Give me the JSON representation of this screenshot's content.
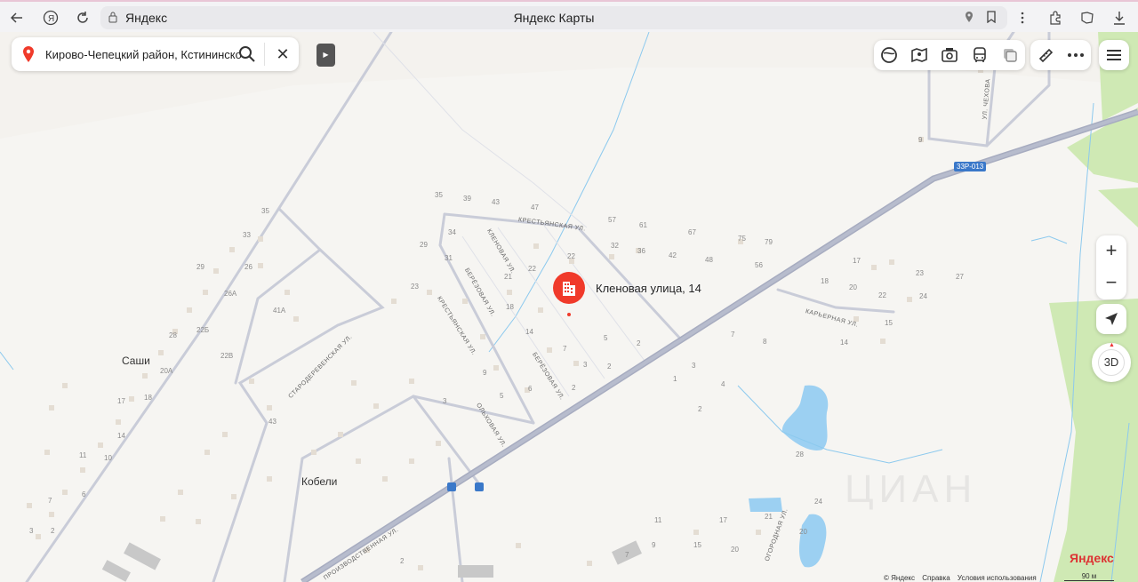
{
  "browser": {
    "site": "Яндекс",
    "page_title": "Яндекс Карты",
    "accent_color": "#e9c6d6"
  },
  "search": {
    "value": "Кирово-Чепецкий район, Кстининское"
  },
  "marker": {
    "label": "Кленовая улица, 14",
    "color": "#f03a2a"
  },
  "highway_badge": "33Р-013",
  "villages": [
    "Саши",
    "Кобели"
  ],
  "streets": [
    "КРЕСТЬЯНСКАЯ УЛ.",
    "КЛЕНОВАЯ УЛ.",
    "БЕРЁЗОВАЯ УЛ.",
    "КРЕСТЬЯНСКАЯ УЛ.",
    "БЕРЁЗОВАЯ УЛ.",
    "ОЛЬХОВАЯ УЛ.",
    "СТАРОДЕРЕВЕНСКАЯ УЛ.",
    "ПРОИЗВОДСТВЕННАЯ УЛ.",
    "КАРЬЕРНАЯ УЛ.",
    "ОГОРОДНАЯ УЛ.",
    "УЛ. ЧЕХОВА"
  ],
  "house_numbers": [
    "35",
    "39",
    "43",
    "47",
    "57",
    "61",
    "67",
    "75",
    "79",
    "29",
    "34",
    "22",
    "32",
    "36",
    "42",
    "48",
    "56",
    "31",
    "22",
    "21",
    "23",
    "18",
    "14",
    "7",
    "5",
    "2",
    "3",
    "2",
    "9",
    "5",
    "6",
    "2",
    "3",
    "17",
    "23",
    "27",
    "18",
    "20",
    "22",
    "24",
    "15",
    "14",
    "7",
    "8",
    "3",
    "1",
    "4",
    "2",
    "28",
    "11",
    "17",
    "21",
    "24",
    "20",
    "9",
    "15",
    "20",
    "7",
    "35",
    "33",
    "29",
    "26",
    "26А",
    "41А",
    "28",
    "22Б",
    "22В",
    "20А",
    "18",
    "17",
    "14",
    "11",
    "10",
    "7",
    "6",
    "3",
    "2",
    "43",
    "2",
    "9"
  ],
  "footer": {
    "copyright": "© Яндекс",
    "help": "Справка",
    "terms": "Условия использования",
    "brand": "Яндекс",
    "scale": "90 м",
    "watermark": "ЦИАН"
  }
}
